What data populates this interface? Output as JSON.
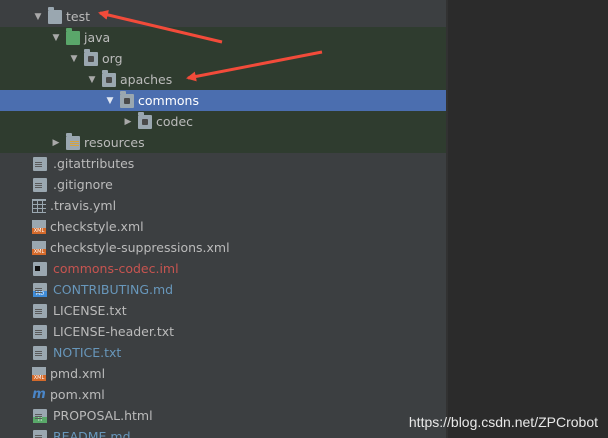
{
  "tree": {
    "rows": [
      {
        "label": "test",
        "expanded": true,
        "type": "folder"
      },
      {
        "label": "java",
        "expanded": true,
        "type": "source-folder"
      },
      {
        "label": "org",
        "expanded": true,
        "type": "package"
      },
      {
        "label": "apaches",
        "expanded": true,
        "type": "package"
      },
      {
        "label": "commons",
        "expanded": true,
        "type": "package",
        "selected": true
      },
      {
        "label": "codec",
        "expanded": false,
        "type": "package"
      },
      {
        "label": "resources",
        "expanded": false,
        "type": "resources-folder"
      },
      {
        "label": ".gitattributes",
        "type": "text-file"
      },
      {
        "label": ".gitignore",
        "type": "text-file"
      },
      {
        "label": ".travis.yml",
        "type": "yaml-file"
      },
      {
        "label": "checkstyle.xml",
        "type": "xml-file"
      },
      {
        "label": "checkstyle-suppressions.xml",
        "type": "xml-file"
      },
      {
        "label": "commons-codec.iml",
        "type": "iml-file",
        "color": "#c75450"
      },
      {
        "label": "CONTRIBUTING.md",
        "type": "md-file",
        "color": "#6897bb"
      },
      {
        "label": "LICENSE.txt",
        "type": "text-file"
      },
      {
        "label": "LICENSE-header.txt",
        "type": "text-file"
      },
      {
        "label": "NOTICE.txt",
        "type": "text-file",
        "color": "#6897bb"
      },
      {
        "label": "pmd.xml",
        "type": "xml-file"
      },
      {
        "label": "pom.xml",
        "type": "maven-file"
      },
      {
        "label": "PROPOSAL.html",
        "type": "html-file"
      },
      {
        "label": "README.md",
        "type": "md-file",
        "color": "#6897bb"
      }
    ]
  },
  "watermark": "https://blog.csdn.net/ZPCrobot",
  "colors": {
    "selection": "#4b6eaf",
    "green_band": "#2f3c2f",
    "annotation": "#f24b3a"
  }
}
